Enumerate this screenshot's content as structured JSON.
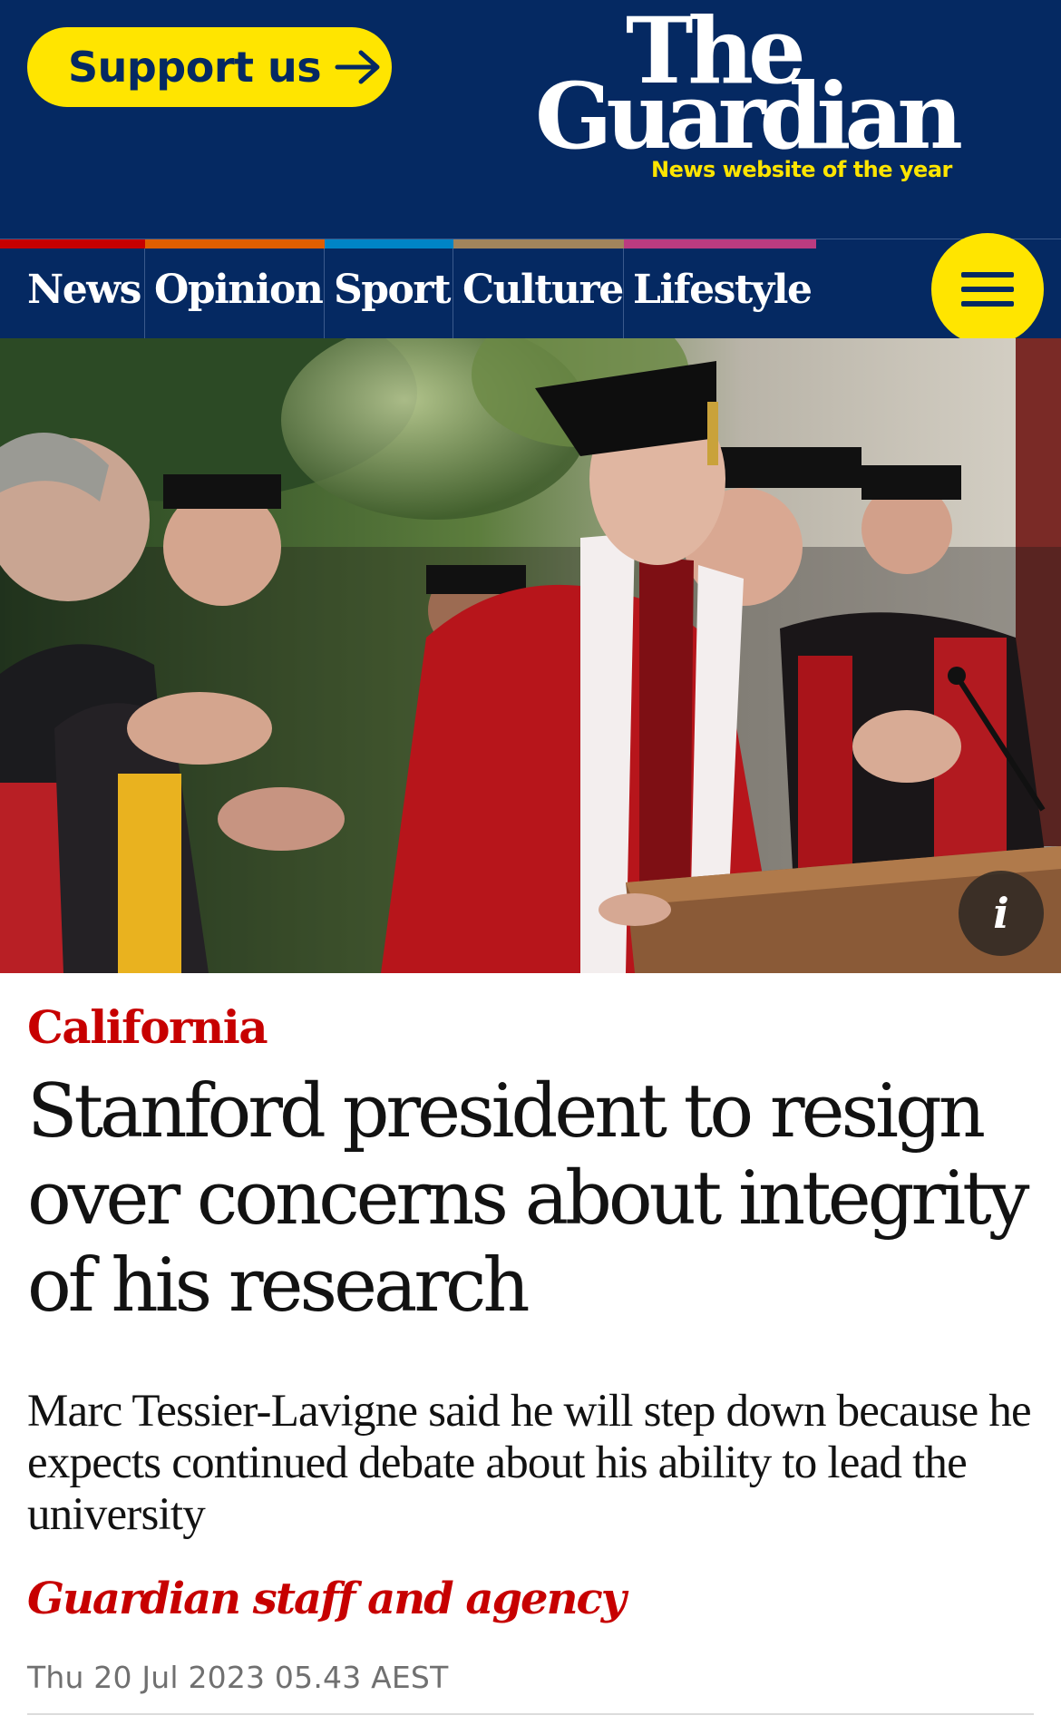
{
  "header": {
    "support_label": "Support us",
    "logo_line1": "The",
    "logo_line2": "Guardian",
    "tagline": "News website of the year"
  },
  "nav": {
    "items": [
      {
        "label": "News",
        "color": "#c70000"
      },
      {
        "label": "Opinion",
        "color": "#e05e00"
      },
      {
        "label": "Sport",
        "color": "#0084c6"
      },
      {
        "label": "Culture",
        "color": "#a1845c"
      },
      {
        "label": "Lifestyle",
        "color": "#bb3b80"
      }
    ],
    "menu_icon": "hamburger-icon"
  },
  "hero": {
    "info_label": "i",
    "info_icon": "info-icon"
  },
  "article": {
    "kicker": "California",
    "headline": "Stanford president to resign over concerns about integrity of his research",
    "standfirst": "Marc Tessier-Lavigne said he will step down because he expects continued debate about his ability to lead the university",
    "byline": "Guardian staff and agency",
    "dateline": "Thu 20 Jul 2023 05.43 AEST"
  },
  "colors": {
    "brand": "#052962",
    "accent_yellow": "#ffe500",
    "news_red": "#c70000"
  }
}
